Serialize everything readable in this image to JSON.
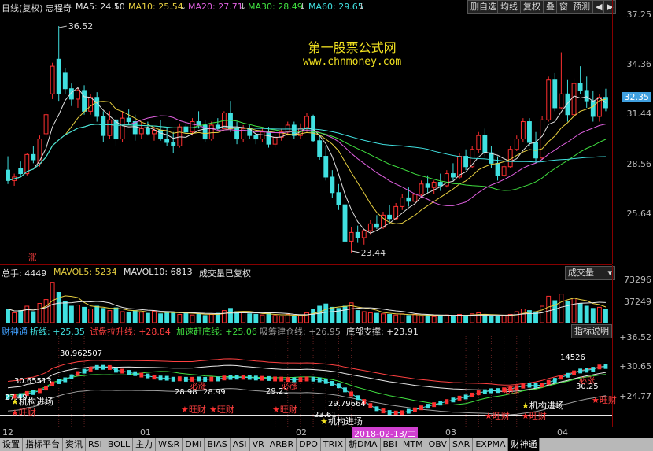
{
  "header": {
    "title": "日线(复权)",
    "name": "忠程奇",
    "ma": [
      {
        "label": "MA5: 24.50",
        "color": "#e0e0e0"
      },
      {
        "label": "MA10: 25.54",
        "color": "#e8d040"
      },
      {
        "label": "MA20: 27.71",
        "color": "#e060e0"
      },
      {
        "label": "MA30: 28.49",
        "color": "#40e040"
      },
      {
        "label": "MA60: 29.65",
        "color": "#40e0e0"
      }
    ],
    "toolbar": [
      "删自选",
      "均线",
      "复权",
      "叠",
      "窗",
      "预测"
    ],
    "nav_left": "◀",
    "nav_right": "▶"
  },
  "watermark": {
    "line1": "第一股票公式网",
    "line2": "www.chnmoney.com"
  },
  "price_axis": [
    "37.25",
    "34.36",
    "32.35",
    "31.44",
    "28.56",
    "25.64"
  ],
  "price_current": "32.35",
  "price_marks": {
    "high": "36.52",
    "low": "23.44",
    "zhang": "涨"
  },
  "volume": {
    "header": [
      "总手: 4449",
      "MAVOL5: 5234",
      "MAVOL10: 6813",
      "成交量已复权"
    ],
    "header_colors": [
      "#e0e0e0",
      "#e8d040",
      "#e8e8e8",
      "#e0e0e0"
    ],
    "selector": "成交量",
    "axis": [
      "73296",
      "37249"
    ]
  },
  "indicator": {
    "header": [
      {
        "text": "财神通",
        "color": "#40a0ff"
      },
      {
        "text": "折线: +25.35",
        "color": "#40e0e0"
      },
      {
        "text": "试盘拉升线: +28.84",
        "color": "#ff4040"
      },
      {
        "text": "加速赶底线: +25.06",
        "color": "#40e040"
      },
      {
        "text": "吸筹建仓线: +26.95",
        "color": "#a0a0a0"
      },
      {
        "text": "底部支撑: +23.91",
        "color": "#e0e0e0"
      }
    ],
    "help_button": "指标说明",
    "axis": [
      "+36.52",
      "+30.65",
      "+24.77"
    ],
    "labels": [
      {
        "text": "30.962507",
        "color": "#fff"
      },
      {
        "text": "30.65513",
        "color": "#fff"
      },
      {
        "text": "27.49",
        "color": "#fff"
      },
      {
        "text": "28.98",
        "color": "#fff"
      },
      {
        "text": "28.99",
        "color": "#fff"
      },
      {
        "text": "29.21",
        "color": "#fff"
      },
      {
        "text": "29.79664",
        "color": "#fff"
      },
      {
        "text": "23.61",
        "color": "#fff"
      },
      {
        "text": "14526",
        "color": "#fff"
      },
      {
        "text": "30.25",
        "color": "#fff"
      },
      {
        "text": "必涨",
        "color": "#ff4040"
      },
      {
        "text": "必涨",
        "color": "#ff4040"
      },
      {
        "text": "必涨",
        "color": "#ff4040"
      },
      {
        "text": "必涨",
        "color": "#ff4040"
      }
    ],
    "stars": [
      {
        "text": "机构进场",
        "color": "#fff"
      },
      {
        "text": "旺财",
        "color": "#ff4040"
      },
      {
        "text": "旺财",
        "color": "#ff4040"
      },
      {
        "text": "旺财",
        "color": "#ff4040"
      },
      {
        "text": "旺财",
        "color": "#ff4040"
      },
      {
        "text": "机构进场",
        "color": "#fff"
      },
      {
        "text": "旺财",
        "color": "#ff4040"
      },
      {
        "text": "机构进场",
        "color": "#fff"
      },
      {
        "text": "旺财",
        "color": "#ff4040"
      },
      {
        "text": "旺财",
        "color": "#ff4040"
      },
      {
        "text": "旺财",
        "color": "#ff4040"
      }
    ]
  },
  "dates": {
    "labels": [
      "12",
      "01",
      "02",
      "03",
      "04"
    ],
    "selected": "2018-02-13/二"
  },
  "tabs": [
    "设置",
    "指标平台",
    "资讯",
    "RSI",
    "BOLL",
    "主力",
    "W&R",
    "DMI",
    "BIAS",
    "ASI",
    "VR",
    "ARBR",
    "DPO",
    "TRIX",
    "新DMA",
    "BBI",
    "MTM",
    "OBV",
    "SAR",
    "EXPMA",
    "财神通"
  ],
  "active_tab": "财神通",
  "colors": {
    "up": "#ff3030",
    "down": "#40e0e0",
    "grid": "#800000"
  },
  "chart_data": {
    "type": "candlestick",
    "ohlc": [
      [
        28.2,
        29.0,
        27.4,
        27.6
      ],
      [
        27.6,
        28.0,
        27.3,
        27.8
      ],
      [
        28.3,
        28.7,
        27.9,
        28.0
      ],
      [
        28.0,
        29.2,
        27.9,
        29.1
      ],
      [
        29.1,
        29.6,
        28.6,
        28.8
      ],
      [
        28.6,
        30.2,
        28.4,
        30.0
      ],
      [
        30.3,
        31.6,
        30.1,
        31.4
      ],
      [
        32.6,
        34.4,
        32.3,
        34.2
      ],
      [
        34.6,
        36.52,
        32.2,
        32.6
      ],
      [
        33.8,
        34.1,
        32.6,
        32.9
      ],
      [
        32.9,
        33.2,
        31.9,
        32.3
      ],
      [
        32.3,
        33.0,
        31.8,
        32.8
      ],
      [
        32.8,
        33.1,
        31.4,
        31.6
      ],
      [
        31.6,
        32.6,
        31.4,
        32.4
      ],
      [
        32.4,
        32.7,
        31.0,
        31.3
      ],
      [
        31.3,
        31.6,
        29.8,
        30.2
      ],
      [
        30.2,
        31.6,
        30.0,
        31.1
      ],
      [
        31.1,
        31.4,
        29.6,
        30.0
      ],
      [
        30.0,
        31.6,
        29.8,
        31.2
      ],
      [
        31.2,
        31.7,
        30.8,
        31.0
      ],
      [
        31.0,
        31.4,
        29.9,
        30.3
      ],
      [
        30.3,
        31.0,
        30.0,
        30.6
      ],
      [
        30.6,
        31.0,
        30.2,
        30.3
      ],
      [
        30.3,
        30.7,
        29.9,
        30.5
      ],
      [
        30.5,
        31.1,
        29.9,
        30.0
      ],
      [
        30.0,
        30.7,
        29.6,
        29.8
      ],
      [
        29.8,
        30.4,
        29.2,
        29.6
      ],
      [
        29.6,
        30.9,
        29.5,
        30.7
      ],
      [
        30.7,
        31.0,
        30.3,
        30.4
      ],
      [
        30.4,
        31.2,
        30.2,
        31.0
      ],
      [
        31.0,
        31.6,
        30.6,
        30.8
      ],
      [
        30.8,
        31.1,
        29.8,
        30.0
      ],
      [
        30.0,
        31.0,
        29.9,
        30.8
      ],
      [
        30.8,
        31.2,
        30.5,
        30.6
      ],
      [
        30.6,
        31.6,
        30.6,
        31.5
      ],
      [
        31.5,
        32.2,
        30.4,
        30.6
      ],
      [
        30.6,
        31.0,
        29.7,
        30.0
      ],
      [
        30.0,
        30.8,
        29.8,
        30.6
      ],
      [
        30.6,
        30.8,
        30.0,
        30.2
      ],
      [
        30.2,
        30.5,
        29.7,
        30.0
      ],
      [
        30.0,
        30.6,
        29.8,
        30.4
      ],
      [
        30.4,
        30.7,
        29.5,
        29.7
      ],
      [
        29.7,
        30.3,
        29.5,
        30.1
      ],
      [
        30.1,
        30.6,
        29.9,
        30.4
      ],
      [
        30.4,
        31.0,
        30.2,
        30.8
      ],
      [
        30.8,
        31.0,
        30.0,
        30.2
      ],
      [
        30.2,
        30.9,
        30.0,
        30.6
      ],
      [
        30.6,
        31.5,
        30.4,
        31.3
      ],
      [
        31.3,
        31.4,
        29.8,
        29.9
      ],
      [
        29.9,
        30.2,
        28.8,
        29.0
      ],
      [
        29.0,
        29.6,
        27.6,
        27.8
      ],
      [
        27.8,
        28.2,
        26.6,
        26.9
      ],
      [
        26.9,
        27.4,
        25.9,
        26.2
      ],
      [
        26.2,
        26.4,
        23.9,
        24.1
      ],
      [
        24.1,
        24.9,
        23.44,
        24.6
      ],
      [
        24.6,
        25.0,
        24.0,
        24.3
      ],
      [
        24.3,
        24.8,
        23.9,
        24.7
      ],
      [
        24.7,
        25.3,
        24.5,
        25.1
      ],
      [
        25.1,
        25.6,
        24.8,
        24.9
      ],
      [
        24.9,
        25.8,
        24.8,
        25.6
      ],
      [
        25.6,
        26.2,
        25.2,
        25.4
      ],
      [
        25.4,
        26.3,
        25.3,
        26.1
      ],
      [
        26.1,
        26.8,
        25.9,
        26.6
      ],
      [
        26.6,
        27.2,
        26.1,
        26.4
      ],
      [
        26.4,
        27.0,
        26.0,
        26.8
      ],
      [
        26.8,
        27.6,
        26.6,
        27.4
      ],
      [
        27.4,
        27.9,
        26.9,
        27.2
      ],
      [
        27.2,
        27.6,
        26.8,
        27.5
      ],
      [
        27.5,
        28.0,
        27.0,
        27.3
      ],
      [
        27.3,
        28.2,
        27.2,
        28.0
      ],
      [
        28.0,
        28.6,
        27.6,
        27.8
      ],
      [
        27.8,
        29.2,
        27.7,
        29.0
      ],
      [
        29.0,
        29.4,
        28.2,
        28.4
      ],
      [
        28.4,
        29.6,
        28.3,
        29.4
      ],
      [
        29.4,
        30.4,
        29.2,
        30.2
      ],
      [
        30.2,
        30.6,
        29.0,
        29.2
      ],
      [
        29.2,
        29.6,
        28.3,
        28.6
      ],
      [
        28.6,
        29.0,
        27.6,
        27.9
      ],
      [
        27.9,
        28.6,
        27.8,
        28.4
      ],
      [
        28.4,
        29.6,
        28.3,
        29.4
      ],
      [
        29.4,
        30.2,
        29.3,
        30.0
      ],
      [
        30.0,
        31.2,
        29.8,
        31.0
      ],
      [
        31.0,
        31.2,
        29.6,
        29.8
      ],
      [
        29.8,
        30.4,
        28.6,
        28.9
      ],
      [
        28.9,
        31.3,
        28.8,
        31.1
      ],
      [
        31.1,
        33.6,
        31.0,
        33.4
      ],
      [
        33.4,
        33.8,
        31.6,
        31.8
      ],
      [
        31.8,
        35.0,
        31.7,
        32.6
      ],
      [
        32.6,
        33.4,
        31.0,
        31.4
      ],
      [
        31.4,
        33.5,
        31.2,
        33.2
      ],
      [
        33.2,
        34.2,
        32.6,
        32.8
      ],
      [
        32.8,
        33.6,
        31.8,
        32.2
      ],
      [
        32.2,
        32.8,
        31.0,
        31.3
      ],
      [
        31.3,
        32.6,
        31.0,
        32.4
      ],
      [
        32.4,
        32.9,
        31.6,
        31.8
      ]
    ],
    "volume": [
      25000,
      18000,
      22000,
      30000,
      20000,
      35000,
      42000,
      73296,
      55000,
      38000,
      30000,
      32000,
      28000,
      25000,
      30000,
      26000,
      22000,
      27000,
      20000,
      18000,
      22000,
      19000,
      17000,
      21000,
      16000,
      20000,
      18000,
      15000,
      19000,
      14000,
      16000,
      13000,
      15000,
      17000,
      22000,
      26000,
      20000,
      18000,
      16000,
      15000,
      14000,
      17000,
      13000,
      12000,
      15000,
      11000,
      14000,
      18000,
      25000,
      30000,
      34000,
      28000,
      26000,
      30000,
      36000,
      22000,
      20000,
      18000,
      17000,
      16000,
      15000,
      14000,
      16000,
      13000,
      15000,
      12000,
      14000,
      11000,
      13000,
      14000,
      12000,
      15000,
      13000,
      16000,
      18000,
      14000,
      12000,
      11000,
      13000,
      15000,
      20000,
      25000,
      22000,
      18000,
      30000,
      48000,
      40000,
      52000,
      38000,
      45000,
      35000,
      30000,
      26000,
      28000,
      24000
    ],
    "price_range": [
      22.8,
      37.25
    ],
    "volume_max": 80000
  }
}
